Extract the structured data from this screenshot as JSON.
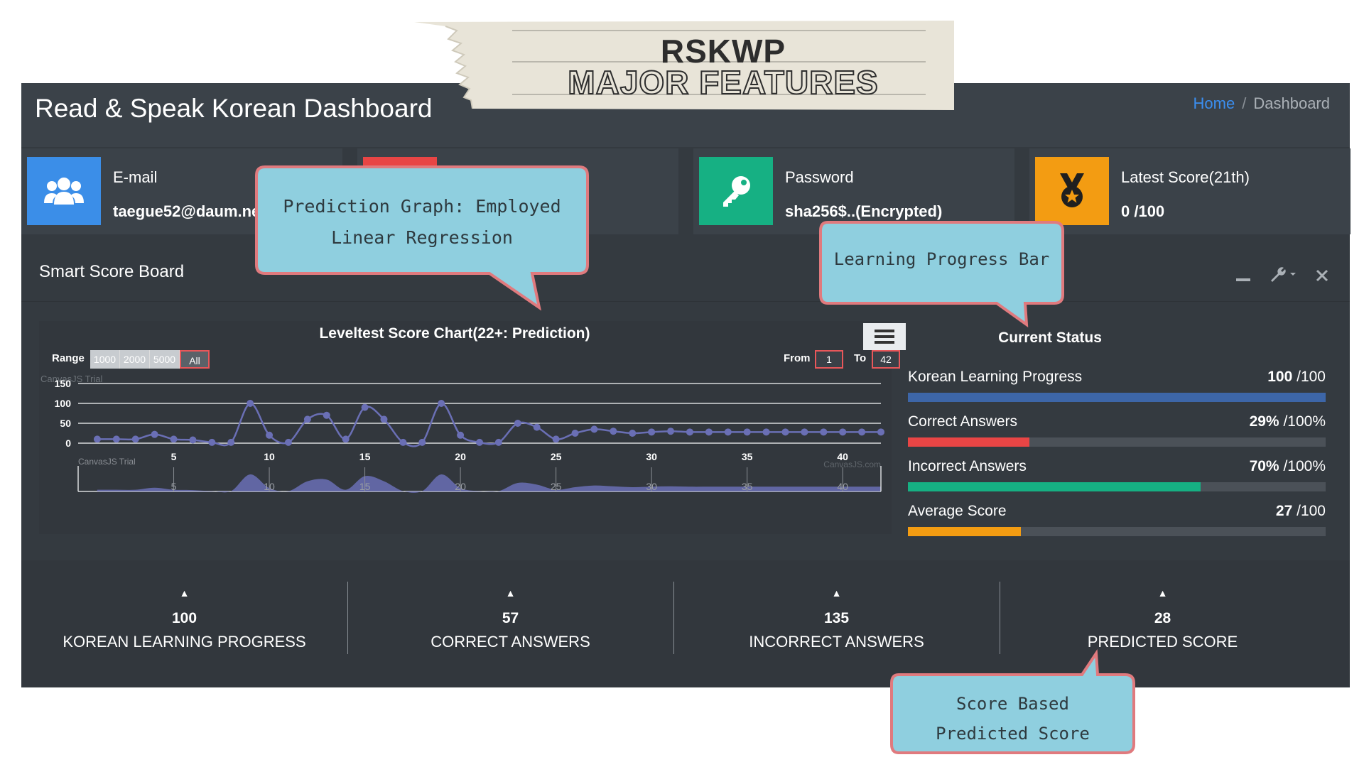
{
  "banner": {
    "line1": "RSKWP",
    "line2": "MAJOR FEATURES"
  },
  "header": {
    "title": "Read & Speak Korean Dashboard",
    "breadcrumb": {
      "home": "Home",
      "separator": "/",
      "current": "Dashboard"
    }
  },
  "info_boxes": [
    {
      "label": "E-mail",
      "value": "taegue52@daum.ne",
      "color": "#3b8ee8",
      "icon": "users-icon"
    },
    {
      "label": "",
      "value": "",
      "color": "#e84545",
      "icon": ""
    },
    {
      "label": "Password",
      "value": "sha256$..(Encrypted)",
      "color": "#16b083",
      "icon": "key-icon"
    },
    {
      "label": "Latest Score(21th)",
      "value": "0 /100",
      "color": "#f39c12",
      "icon": "medal-icon"
    }
  ],
  "card": {
    "title": "Smart Score Board",
    "tools": [
      "minimize-icon",
      "wrench-icon",
      "close-icon"
    ]
  },
  "chart_panel": {
    "range_label": "Range",
    "range_buttons": [
      "1000",
      "2000",
      "5000",
      "All"
    ],
    "active_range": "All",
    "from_label": "From",
    "from_value": "1",
    "to_label": "To",
    "to_value": "42",
    "watermark": "CanvasJS Trial",
    "credit": "CanvasJS.com"
  },
  "chart_data": {
    "type": "line",
    "title": "Leveltest Score Chart(22+: Prediction)",
    "x": [
      1,
      2,
      3,
      4,
      5,
      6,
      7,
      8,
      9,
      10,
      11,
      12,
      13,
      14,
      15,
      16,
      17,
      18,
      19,
      20,
      21,
      22,
      23,
      24,
      25,
      26,
      27,
      28,
      29,
      30,
      31,
      32,
      33,
      34,
      35,
      36,
      37,
      38,
      39,
      40,
      41,
      42
    ],
    "series": [
      {
        "name": "",
        "values": [
          10,
          10,
          10,
          22,
          10,
          8,
          2,
          2,
          100,
          20,
          2,
          60,
          70,
          10,
          90,
          60,
          2,
          2,
          100,
          20,
          2,
          2,
          50,
          40,
          10,
          25,
          35,
          30,
          25,
          28,
          30,
          28,
          28,
          28,
          28,
          28,
          28,
          28,
          28,
          28,
          28,
          28
        ]
      }
    ],
    "xticks": [
      5,
      10,
      15,
      20,
      25,
      30,
      35,
      40
    ],
    "yticks": [
      0,
      50,
      100,
      150
    ],
    "ylim": [
      0,
      150
    ],
    "xlim": [
      0,
      42
    ],
    "grid": true,
    "navigator": true,
    "line_color": "#6a6fb5"
  },
  "status": {
    "title": "Current Status",
    "items": [
      {
        "label": "Korean Learning Progress",
        "value": "100",
        "max": " /100",
        "fraction": 1.0,
        "color": "#3d66a8"
      },
      {
        "label": "Correct Answers",
        "value": "29%",
        "max": " /100%",
        "fraction": 0.29,
        "color": "#e84545"
      },
      {
        "label": "Incorrect Answers",
        "value": "70%",
        "max": " /100%",
        "fraction": 0.7,
        "color": "#16b083"
      },
      {
        "label": "Average Score",
        "value": "27",
        "max": " /100",
        "fraction": 0.27,
        "color": "#f39c12"
      }
    ]
  },
  "footer": [
    {
      "number": "100",
      "label": "KOREAN LEARNING PROGRESS"
    },
    {
      "number": "57",
      "label": "CORRECT ANSWERS"
    },
    {
      "number": "135",
      "label": "INCORRECT ANSWERS"
    },
    {
      "number": "28",
      "label": "PREDICTED SCORE"
    }
  ],
  "callouts": {
    "prediction": {
      "line1": "Prediction Graph: Employed",
      "line2": "Linear Regression"
    },
    "progress": {
      "line1": "Learning Progress Bar"
    },
    "predicted": {
      "line1": "Score Based",
      "line2": "Predicted Score"
    }
  }
}
